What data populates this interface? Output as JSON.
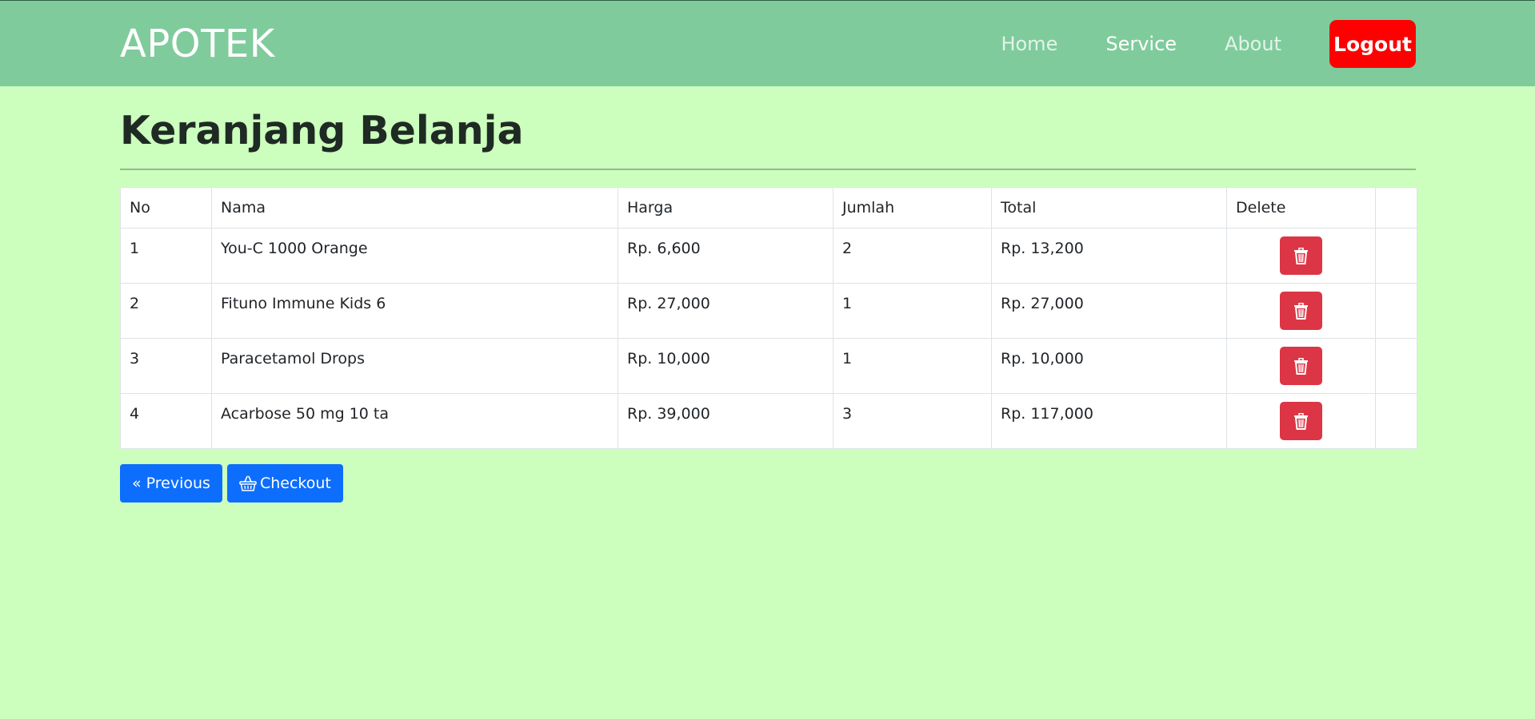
{
  "header": {
    "brand": "APOTEK",
    "nav": [
      "Home",
      "Service",
      "About"
    ],
    "active_nav": "Service",
    "logout_label": "Logout",
    "colors": {
      "navbar_bg": "#7fcb9c",
      "logout_bg": "#ff0000"
    }
  },
  "page": {
    "title": "Keranjang Belanja",
    "background": "#ccffbd"
  },
  "cart": {
    "columns": [
      "No",
      "Nama",
      "Harga",
      "Jumlah",
      "Total",
      "Delete"
    ],
    "rows": [
      {
        "no": "1",
        "nama": "You-C 1000 Orange",
        "harga": "Rp. 6,600",
        "jumlah": "2",
        "total": "Rp. 13,200"
      },
      {
        "no": "2",
        "nama": "Fituno Immune Kids 6",
        "harga": "Rp. 27,000",
        "jumlah": "1",
        "total": "Rp. 27,000"
      },
      {
        "no": "3",
        "nama": "Paracetamol Drops",
        "harga": "Rp. 10,000",
        "jumlah": "1",
        "total": "Rp. 10,000"
      },
      {
        "no": "4",
        "nama": "Acarbose 50 mg 10 ta",
        "harga": "Rp. 39,000",
        "jumlah": "3",
        "total": "Rp. 117,000"
      }
    ],
    "delete_icon": "trash-icon",
    "delete_color": "#dc3545"
  },
  "actions": {
    "previous_label": "« Previous",
    "checkout_label": "Checkout",
    "checkout_icon": "basket-icon",
    "button_color": "#0d6efd"
  }
}
